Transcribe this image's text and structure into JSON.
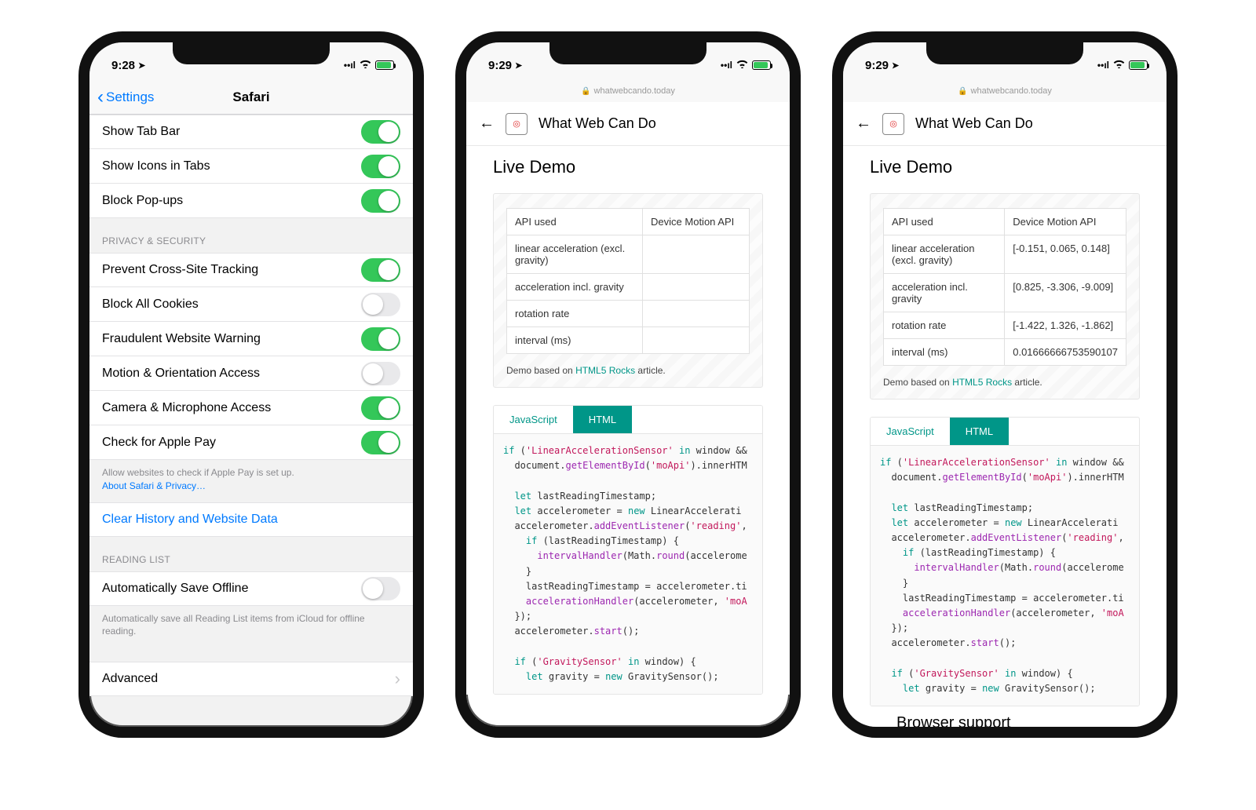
{
  "status": {
    "time1": "9:28",
    "time2": "9:29",
    "time3": "9:29",
    "location_glyph": "➤"
  },
  "screen1": {
    "back": "Settings",
    "title": "Safari",
    "rows": [
      {
        "label": "Show Tab Bar",
        "on": true
      },
      {
        "label": "Show Icons in Tabs",
        "on": true
      },
      {
        "label": "Block Pop-ups",
        "on": true
      }
    ],
    "section_privacy": "PRIVACY & SECURITY",
    "privacy_rows": [
      {
        "label": "Prevent Cross-Site Tracking",
        "on": true
      },
      {
        "label": "Block All Cookies",
        "on": false
      },
      {
        "label": "Fraudulent Website Warning",
        "on": true
      },
      {
        "label": "Motion & Orientation Access",
        "on": false
      },
      {
        "label": "Camera & Microphone Access",
        "on": true
      },
      {
        "label": "Check for Apple Pay",
        "on": true
      }
    ],
    "privacy_footer1": "Allow websites to check if Apple Pay is set up.",
    "privacy_footer_link": "About Safari & Privacy…",
    "clear_history": "Clear History and Website Data",
    "section_reading": "READING LIST",
    "reading_row": {
      "label": "Automatically Save Offline",
      "on": false
    },
    "reading_footer": "Automatically save all Reading List items from iCloud for offline reading.",
    "advanced": "Advanced"
  },
  "wwcd": {
    "url": "whatwebcando.today",
    "app_title": "What Web Can Do",
    "demo_heading": "Live Demo",
    "table_labels": {
      "api_used": "API used",
      "api_value": "Device Motion API",
      "lin_accel": "linear acceleration (excl. gravity)",
      "accel_grav": "acceleration incl. gravity",
      "rot_rate": "rotation rate",
      "interval": "interval (ms)"
    },
    "s2_values": {
      "lin_accel": "",
      "accel_grav": "",
      "rot_rate": "",
      "interval": ""
    },
    "s3_values": {
      "lin_accel": "[-0.151, 0.065, 0.148]",
      "accel_grav": "[0.825, -3.306, -9.009]",
      "rot_rate": "[-1.422, 1.326, -1.862]",
      "interval": "0.01666666753590107"
    },
    "demo_footer_pre": "Demo based on ",
    "demo_footer_link": "HTML5 Rocks",
    "demo_footer_post": " article.",
    "tab_js": "JavaScript",
    "tab_html": "HTML",
    "browser_support": "Browser support"
  }
}
